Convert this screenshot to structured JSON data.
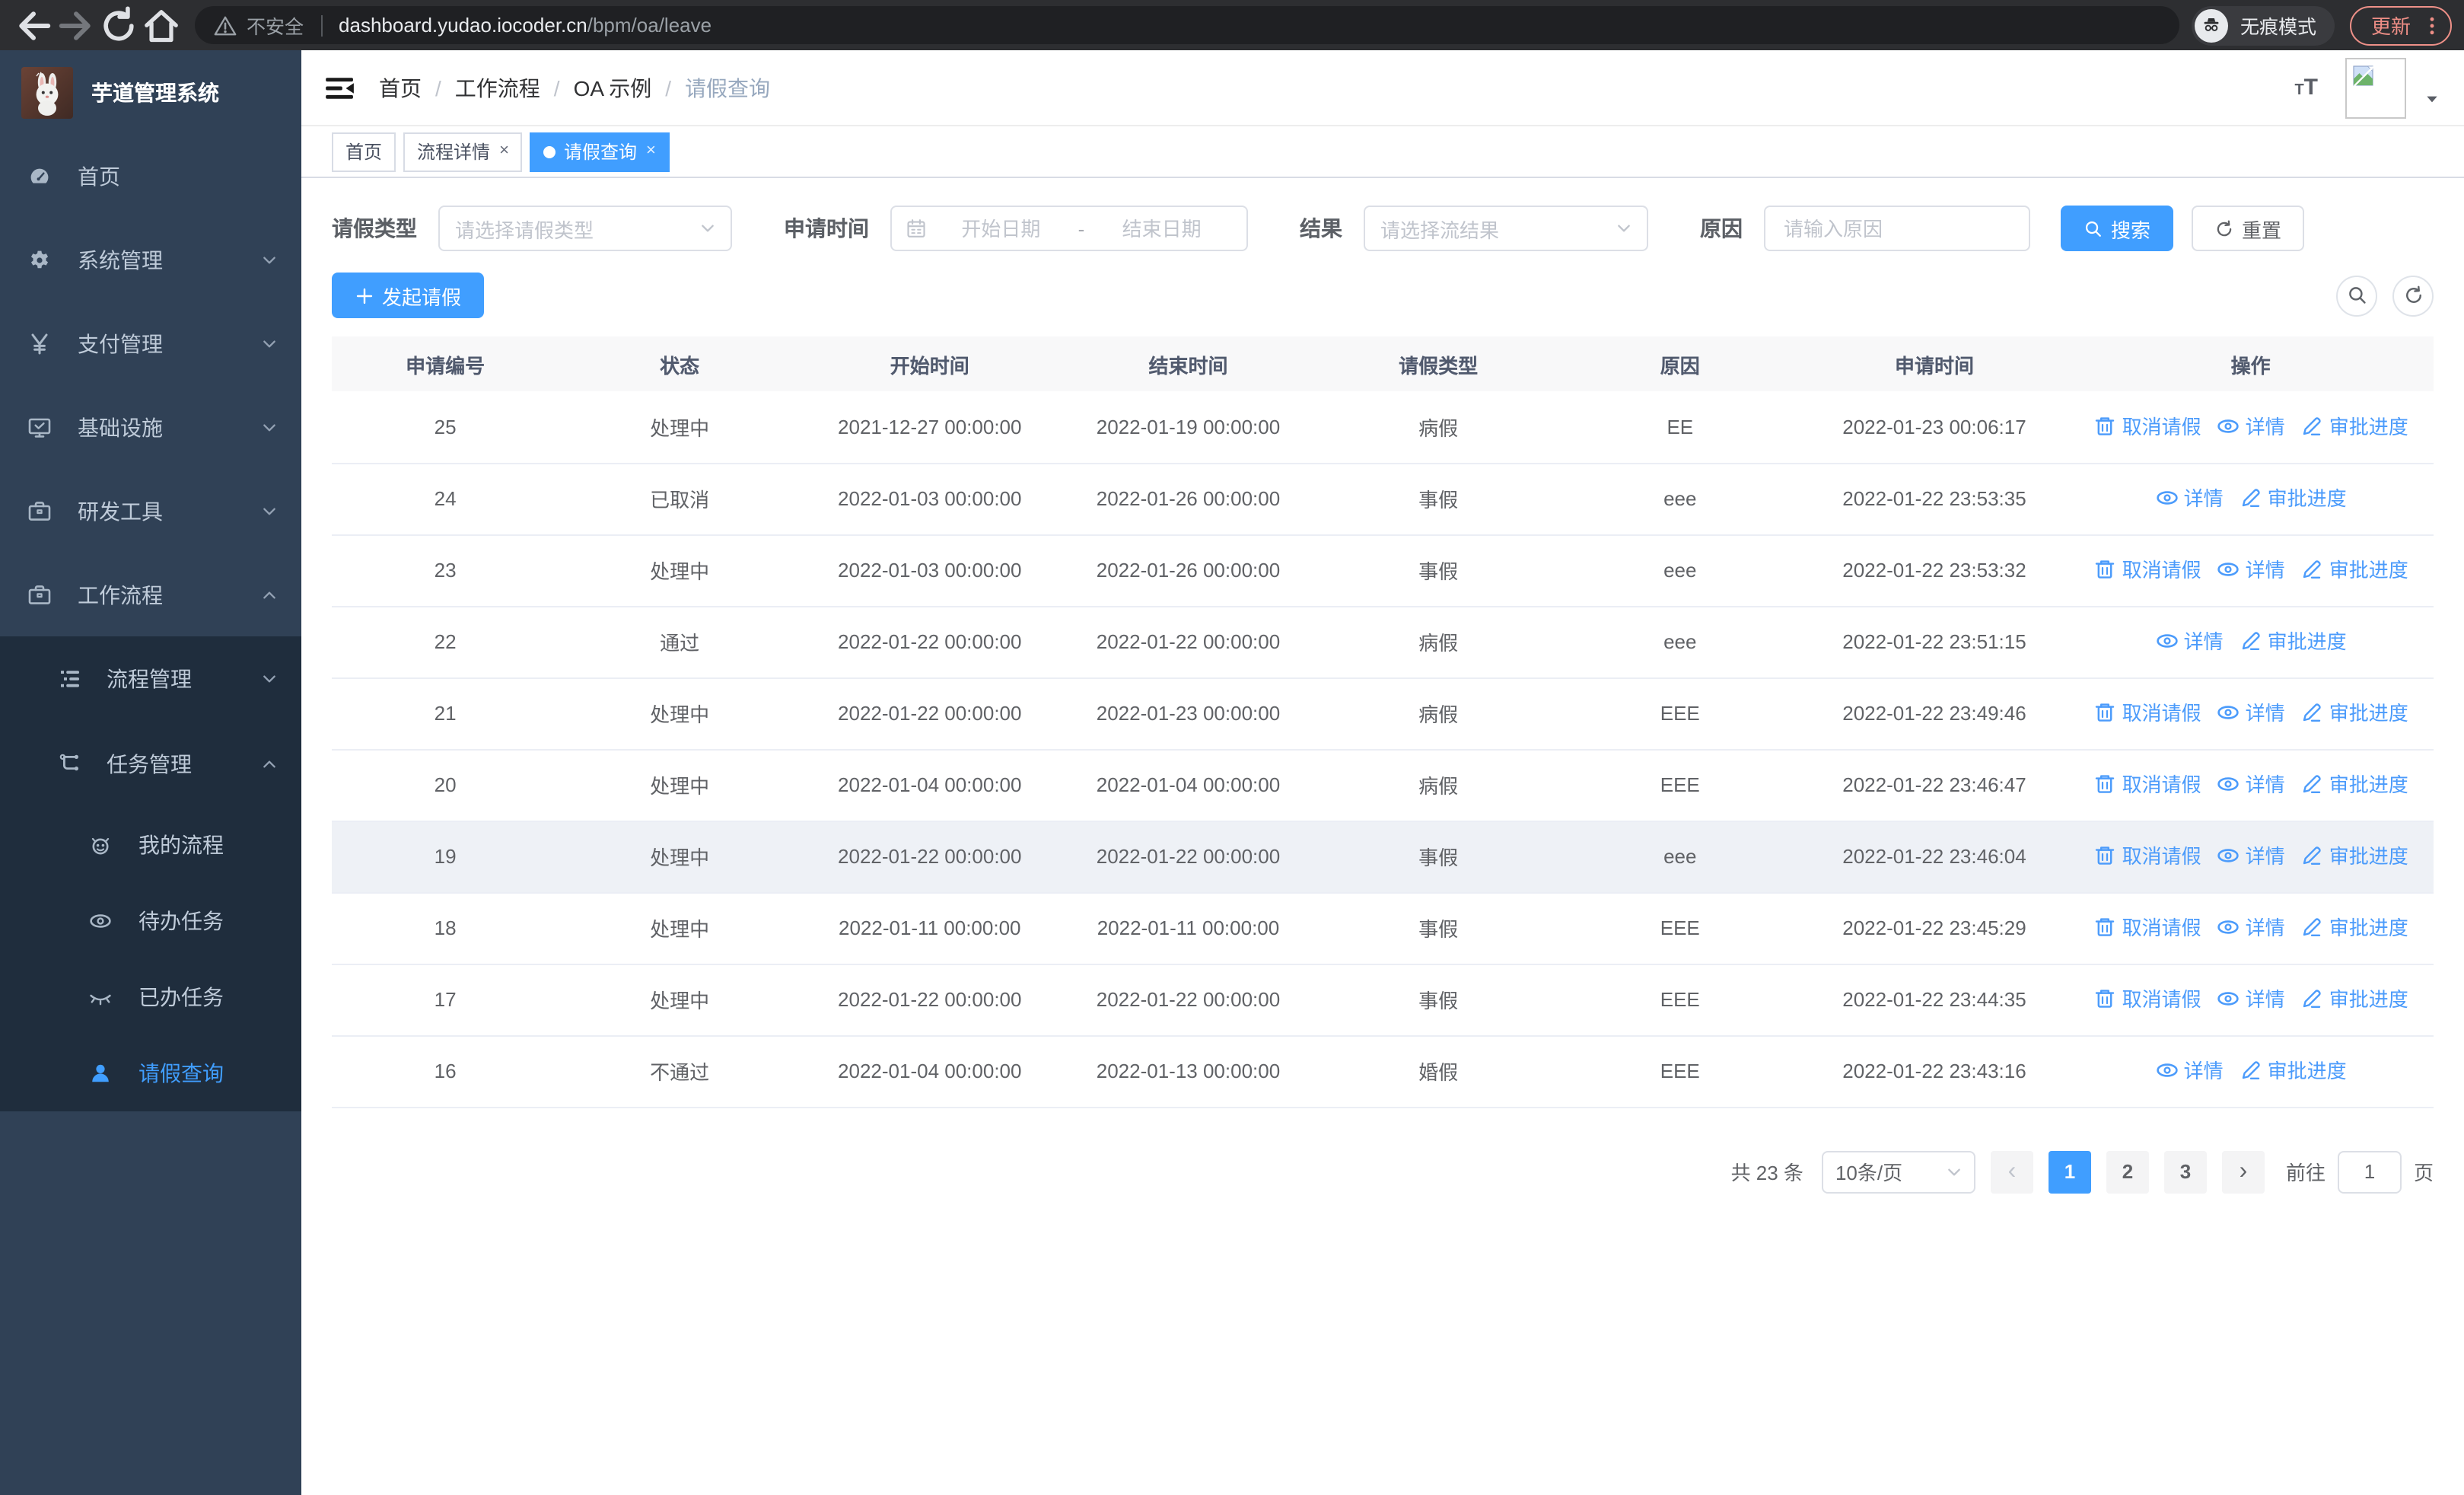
{
  "browser": {
    "security_label": "不安全",
    "url_host": "dashboard.yudao.iocoder.cn",
    "url_path": "/bpm/oa/leave",
    "incognito_label": "无痕模式",
    "update_label": "更新"
  },
  "sidebar": {
    "title": "芋道管理系统",
    "menu": [
      {
        "label": "首页",
        "icon": "dashboard",
        "level": 0
      },
      {
        "label": "系统管理",
        "icon": "gear",
        "level": 0,
        "chevron": "down"
      },
      {
        "label": "支付管理",
        "icon": "yen",
        "level": 0,
        "chevron": "down"
      },
      {
        "label": "基础设施",
        "icon": "monitor",
        "level": 0,
        "chevron": "down"
      },
      {
        "label": "研发工具",
        "icon": "toolbox",
        "level": 0,
        "chevron": "down"
      },
      {
        "label": "工作流程",
        "icon": "toolbox",
        "level": 0,
        "chevron": "up"
      },
      {
        "label": "流程管理",
        "icon": "list-tree",
        "level": 1,
        "chevron": "down",
        "dark": true
      },
      {
        "label": "任务管理",
        "icon": "flow",
        "level": 1,
        "chevron": "up",
        "dark": true
      },
      {
        "label": "我的流程",
        "icon": "robot",
        "level": 2,
        "dark": true
      },
      {
        "label": "待办任务",
        "icon": "eye-open",
        "level": 2,
        "dark": true
      },
      {
        "label": "已办任务",
        "icon": "eye-closed",
        "level": 2,
        "dark": true
      },
      {
        "label": "请假查询",
        "icon": "user",
        "level": 2,
        "dark": true,
        "active": true
      }
    ]
  },
  "navbar": {
    "breadcrumb": [
      {
        "label": "首页"
      },
      {
        "label": "工作流程"
      },
      {
        "label": "OA 示例"
      },
      {
        "label": "请假查询",
        "muted": true
      }
    ]
  },
  "tabs": [
    {
      "label": "首页"
    },
    {
      "label": "流程详情",
      "closable": true
    },
    {
      "label": "请假查询",
      "closable": true,
      "active": true
    }
  ],
  "filters": {
    "leave_type_label": "请假类型",
    "leave_type_placeholder": "请选择请假类型",
    "apply_time_label": "申请时间",
    "start_date_placeholder": "开始日期",
    "range_separator": "-",
    "end_date_placeholder": "结束日期",
    "result_label": "结果",
    "result_placeholder": "请选择流结果",
    "reason_label": "原因",
    "reason_placeholder": "请输入原因",
    "search_label": "搜索",
    "reset_label": "重置"
  },
  "toolbar": {
    "create_label": "发起请假"
  },
  "table": {
    "columns": [
      "申请编号",
      "状态",
      "开始时间",
      "结束时间",
      "请假类型",
      "原因",
      "申请时间",
      "操作"
    ],
    "action_labels": {
      "cancel": "取消请假",
      "detail": "详情",
      "progress": "审批进度"
    },
    "rows": [
      {
        "id": "25",
        "status": "处理中",
        "start": "2021-12-27 00:00:00",
        "end": "2022-01-19 00:00:00",
        "type": "病假",
        "reason": "EE",
        "applied": "2022-01-23 00:06:17",
        "actions": [
          "cancel",
          "detail",
          "progress"
        ]
      },
      {
        "id": "24",
        "status": "已取消",
        "start": "2022-01-03 00:00:00",
        "end": "2022-01-26 00:00:00",
        "type": "事假",
        "reason": "eee",
        "applied": "2022-01-22 23:53:35",
        "actions": [
          "detail",
          "progress"
        ]
      },
      {
        "id": "23",
        "status": "处理中",
        "start": "2022-01-03 00:00:00",
        "end": "2022-01-26 00:00:00",
        "type": "事假",
        "reason": "eee",
        "applied": "2022-01-22 23:53:32",
        "actions": [
          "cancel",
          "detail",
          "progress"
        ]
      },
      {
        "id": "22",
        "status": "通过",
        "start": "2022-01-22 00:00:00",
        "end": "2022-01-22 00:00:00",
        "type": "病假",
        "reason": "eee",
        "applied": "2022-01-22 23:51:15",
        "actions": [
          "detail",
          "progress"
        ]
      },
      {
        "id": "21",
        "status": "处理中",
        "start": "2022-01-22 00:00:00",
        "end": "2022-01-23 00:00:00",
        "type": "病假",
        "reason": "EEE",
        "applied": "2022-01-22 23:49:46",
        "actions": [
          "cancel",
          "detail",
          "progress"
        ]
      },
      {
        "id": "20",
        "status": "处理中",
        "start": "2022-01-04 00:00:00",
        "end": "2022-01-04 00:00:00",
        "type": "病假",
        "reason": "EEE",
        "applied": "2022-01-22 23:46:47",
        "actions": [
          "cancel",
          "detail",
          "progress"
        ]
      },
      {
        "id": "19",
        "status": "处理中",
        "start": "2022-01-22 00:00:00",
        "end": "2022-01-22 00:00:00",
        "type": "事假",
        "reason": "eee",
        "applied": "2022-01-22 23:46:04",
        "actions": [
          "cancel",
          "detail",
          "progress"
        ],
        "highlighted": true
      },
      {
        "id": "18",
        "status": "处理中",
        "start": "2022-01-11 00:00:00",
        "end": "2022-01-11 00:00:00",
        "type": "事假",
        "reason": "EEE",
        "applied": "2022-01-22 23:45:29",
        "actions": [
          "cancel",
          "detail",
          "progress"
        ]
      },
      {
        "id": "17",
        "status": "处理中",
        "start": "2022-01-22 00:00:00",
        "end": "2022-01-22 00:00:00",
        "type": "事假",
        "reason": "EEE",
        "applied": "2022-01-22 23:44:35",
        "actions": [
          "cancel",
          "detail",
          "progress"
        ]
      },
      {
        "id": "16",
        "status": "不通过",
        "start": "2022-01-04 00:00:00",
        "end": "2022-01-13 00:00:00",
        "type": "婚假",
        "reason": "EEE",
        "applied": "2022-01-22 23:43:16",
        "actions": [
          "detail",
          "progress"
        ]
      }
    ]
  },
  "pagination": {
    "total": "共 23 条",
    "page_size": "10条/页",
    "prev": "‹",
    "next": "›",
    "pages": [
      "1",
      "2",
      "3"
    ],
    "active_page": "1",
    "goto_label": "前往",
    "goto_value": "1",
    "unit_label": "页"
  },
  "colors": {
    "accent": "#409eff",
    "sidebar_bg": "#304156",
    "submenu_bg": "#1f2d3d",
    "sidebar_text": "#bfcbd9",
    "table_header_bg": "#f8f8f9",
    "row_highlight": "#eef1f6",
    "update_button": "#ee8e86"
  }
}
